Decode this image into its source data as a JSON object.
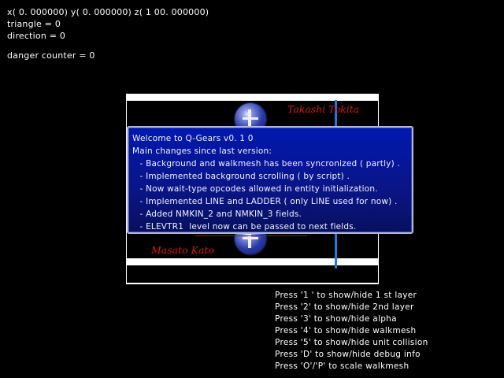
{
  "debug": {
    "position": "x( 0. 000000)  y( 0. 000000)  z( 1 00. 000000)",
    "triangle": "triangle = 0",
    "direction": "direction = 0",
    "danger_counter": "danger counter = 0"
  },
  "scene": {
    "credit_top": "Takashi Tokita",
    "credit_bottom": "Masato Kato"
  },
  "dialog": {
    "title": "Welcome to Q-Gears v0. 1 0",
    "subtitle": "Main changes since last version:",
    "items": [
      " - Background and walkmesh has been syncronized ( partly) .",
      " - Implemented background scrolling ( by script) .",
      " - Now wait-type opcodes allowed in entity initialization.",
      " - Implemented LINE and LADDER ( only LINE used for now) .",
      " - Added NMKIN_2 and NMKIN_3 fields.",
      " - ELEVTR1  level now can be passed to next fields."
    ]
  },
  "help": [
    "Press '1 ' to show/hide 1 st layer",
    "Press '2' to show/hide 2nd layer",
    "Press '3' to show/hide alpha",
    "Press '4' to show/hide walkmesh",
    "Press '5' to show/hide unit collision",
    "Press 'D' to show/hide debug info",
    "Press 'O'/'P' to scale walkmesh"
  ],
  "colors": {
    "background": "#000000",
    "dialog_blue": "#0018b0",
    "credit_red": "#d01818",
    "walkmesh_line": "#1f7be0"
  }
}
